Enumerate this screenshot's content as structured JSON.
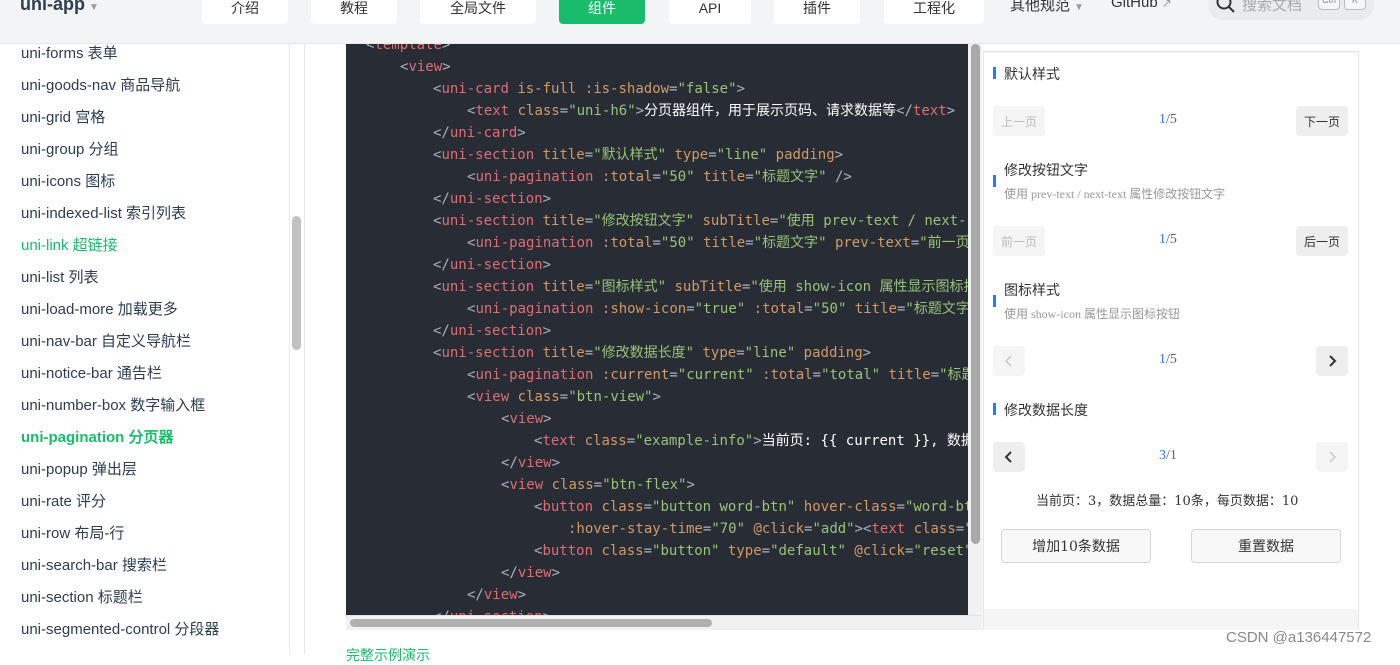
{
  "header": {
    "brand": "uni-app",
    "nav": [
      {
        "label": "介绍"
      },
      {
        "label": "教程"
      },
      {
        "label": "全局文件"
      },
      {
        "label": "组件"
      },
      {
        "label": "API"
      },
      {
        "label": "插件"
      },
      {
        "label": "工程化"
      }
    ],
    "other_label": "其他规范",
    "github_label": "GitHub",
    "search_placeholder": "搜索文档",
    "kbd_ctrl": "Ctrl",
    "kbd_k": "K"
  },
  "sidebar": {
    "items": [
      {
        "label": "uni-forms 表单"
      },
      {
        "label": "uni-goods-nav 商品导航"
      },
      {
        "label": "uni-grid 宫格"
      },
      {
        "label": "uni-group 分组"
      },
      {
        "label": "uni-icons 图标"
      },
      {
        "label": "uni-indexed-list 索引列表"
      },
      {
        "label": "uni-link 超链接"
      },
      {
        "label": "uni-list 列表"
      },
      {
        "label": "uni-load-more 加载更多"
      },
      {
        "label": "uni-nav-bar 自定义导航栏"
      },
      {
        "label": "uni-notice-bar 通告栏"
      },
      {
        "label": "uni-number-box 数字输入框"
      },
      {
        "label": "uni-pagination 分页器"
      },
      {
        "label": "uni-popup 弹出层"
      },
      {
        "label": "uni-rate 评分"
      },
      {
        "label": "uni-row 布局-行"
      },
      {
        "label": "uni-search-bar 搜索栏"
      },
      {
        "label": "uni-section 标题栏"
      },
      {
        "label": "uni-segmented-control 分段器"
      }
    ]
  },
  "code": {
    "l1": {
      "t": "template"
    },
    "l2": {
      "t": "view"
    },
    "l3": {
      "t": "uni-card",
      "a1": "is-full",
      "a2": ":is-shadow",
      "v2": "\"false\""
    },
    "l4": {
      "t": "text",
      "a1": "class",
      "v1": "\"uni-h6\"",
      "txt": "分页器组件，用于展示页码、请求数据等",
      "te": "text"
    },
    "l5": {
      "t": "uni-card"
    },
    "l6": {
      "t": "uni-section",
      "a1": "title",
      "v1": "\"默认样式\"",
      "a2": "type",
      "v2": "\"line\"",
      "a3": "padding"
    },
    "l7": {
      "t": "uni-pagination",
      "a1": ":total",
      "v1": "\"50\"",
      "a2": "title",
      "v2": "\"标题文字\"",
      "tail": " />"
    },
    "l8": {
      "t": "uni-section"
    },
    "l9": {
      "t": "uni-section",
      "a1": "title",
      "v1": "\"修改按钮文字\"",
      "a2": "subTitle",
      "v2": "\"使用 prev-text / next-"
    },
    "l10": {
      "t": "uni-pagination",
      "a1": ":total",
      "v1": "\"50\"",
      "a2": "title",
      "v2": "\"标题文字\"",
      "a3": "prev-text",
      "v3": "\"前一页"
    },
    "l11": {
      "t": "uni-section"
    },
    "l12": {
      "t": "uni-section",
      "a1": "title",
      "v1": "\"图标样式\"",
      "a2": "subTitle",
      "v2": "\"使用 show-icon 属性显示图标按"
    },
    "l13": {
      "t": "uni-pagination",
      "a1": ":show-icon",
      "v1": "\"true\"",
      "a2": ":total",
      "v2": "\"50\"",
      "a3": "title",
      "v3": "\"标题文字"
    },
    "l14": {
      "t": "uni-section"
    },
    "l15": {
      "t": "uni-section",
      "a1": "title",
      "v1": "\"修改数据长度\"",
      "a2": "type",
      "v2": "\"line\"",
      "a3": "padding"
    },
    "l16": {
      "t": "uni-pagination",
      "a1": ":current",
      "v1": "\"current\"",
      "a2": ":total",
      "v2": "\"total\"",
      "a3": "title",
      "v3": "\"标题"
    },
    "l17": {
      "t": "view",
      "a1": "class",
      "v1": "\"btn-view\""
    },
    "l18": {
      "t": "view"
    },
    "l19": {
      "t": "text",
      "a1": "class",
      "v1": "\"example-info\"",
      "txt": "当前页: {{ current }}, 数据"
    },
    "l20": {
      "t": "view"
    },
    "l21": {
      "t": "view",
      "a1": "class",
      "v1": "\"btn-flex\""
    },
    "l22": {
      "t": "button",
      "a1": "class",
      "v1": "\"button word-btn\"",
      "a2": "hover-class",
      "v2": "\"word-bt"
    },
    "l23": {
      "a1": ":hover-stay-time",
      "v1": "\"70\"",
      "a2": "@click",
      "v2": "\"add\"",
      "t2": "text",
      "a3": "class",
      "v3": "\""
    },
    "l24": {
      "t": "button",
      "a1": "class",
      "v1": "\"button\"",
      "a2": "type",
      "v2": "\"default\"",
      "a3": "@click",
      "v3": "\"reset\""
    },
    "l25": {
      "t": "view"
    },
    "l26": {
      "t": "view"
    },
    "l27": {
      "t": "uni-section"
    }
  },
  "preview": {
    "sec1": {
      "title": "默认样式",
      "prev": "上一页",
      "next": "下一页",
      "current": "1",
      "total": "/5"
    },
    "sec2": {
      "title": "修改按钮文字",
      "sub": "使用 prev-text / next-text 属性修改按钮文字",
      "prev": "前一页",
      "next": "后一页",
      "current": "1",
      "total": "/5"
    },
    "sec3": {
      "title": "图标样式",
      "sub": "使用 show-icon 属性显示图标按钮",
      "current": "1",
      "total": "/5"
    },
    "sec4": {
      "title": "修改数据长度",
      "current": "3",
      "total": "/1"
    },
    "info": "当前页：3，数据总量：10条，每页数据：10",
    "add_btn": "增加10条数据",
    "reset_btn": "重置数据"
  },
  "below_link": "完整示例演示",
  "watermark": "CSDN @a136447572"
}
